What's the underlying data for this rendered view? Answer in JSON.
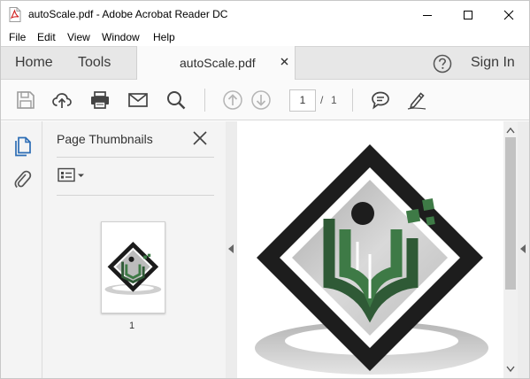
{
  "window": {
    "title": "autoScale.pdf - Adobe Acrobat Reader DC"
  },
  "menu": {
    "items": [
      "File",
      "Edit",
      "View",
      "Window",
      "Help"
    ]
  },
  "nav": {
    "home": "Home",
    "tools": "Tools",
    "doc_tab": "autoScale.pdf",
    "sign_in": "Sign In"
  },
  "toolbar": {
    "current_page": "1",
    "separator": "/",
    "total_pages": "1"
  },
  "panel": {
    "title": "Page Thumbnails",
    "thumbnail_label": "1"
  },
  "colors": {
    "accent_blue": "#2d6db5",
    "logo_green": "#3e7a46",
    "logo_dark": "#1d1d1d"
  },
  "icons": {
    "app": "pdf-file-icon",
    "save": "save-icon",
    "upload": "cloud-upload-icon",
    "print": "print-icon",
    "email": "envelope-icon",
    "search": "search-icon",
    "prev": "page-up-icon",
    "next": "page-down-icon",
    "comment": "comment-icon",
    "sign": "pen-icon",
    "help": "help-icon",
    "thumbnails": "page-thumbnails-icon",
    "attachments": "paperclip-icon"
  }
}
